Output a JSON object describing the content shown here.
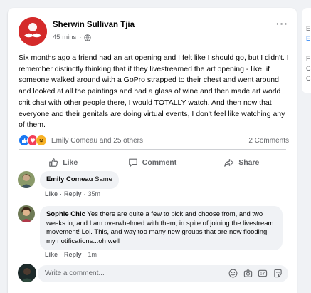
{
  "post": {
    "author": "Sherwin Sullivan Tjia",
    "time": "45 mins",
    "separator": "·",
    "privacy_icon": "globe-icon",
    "more_label": "···",
    "text": "Six months ago a friend had an art opening and I felt like I should go, but I didn't. I remember distinctly thinking that if they livestreamed the art opening - like, if someone walked around with a GoPro strapped to their chest and went around and looked at all the paintings and had a glass of wine and then made art world chit chat with other people there, I would TOTALLY watch. And then now that everyone and their genitals are doing virtual events, I don't feel like watching any of them.",
    "reactions_text": "Emily Comeau and 25 others",
    "comments_count": "2 Comments"
  },
  "actions": {
    "like": "Like",
    "comment": "Comment",
    "share": "Share"
  },
  "comments": [
    {
      "author": "Emily Comeau",
      "text": "Same",
      "like": "Like",
      "reply": "Reply",
      "time": "35m"
    },
    {
      "author": "Sophie Chic",
      "text": "Yes there are quite a few to pick and choose from, and two weeks in, and I am overwhelmed with them, in spite of joining the livestream movement! Lol. This, and way too many new groups that are now flooding my notifications...oh well",
      "like": "Like",
      "reply": "Reply",
      "time": "1m"
    }
  ],
  "composer": {
    "placeholder": "Write a comment..."
  },
  "side": {
    "letters": [
      "E",
      "E",
      "F",
      "C",
      "C"
    ]
  },
  "colors": {
    "brand": "#1877f2",
    "love": "#f33e58",
    "haha": "#f7b125",
    "avatar_red": "#d42a2a"
  }
}
